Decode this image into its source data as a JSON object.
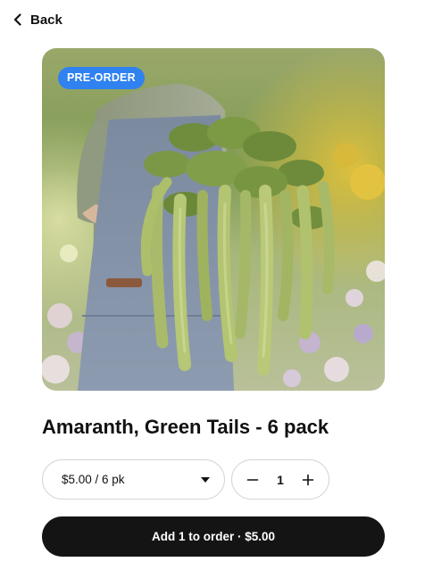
{
  "nav": {
    "back_label": "Back"
  },
  "product": {
    "badge": "PRE-ORDER",
    "title": "Amaranth, Green Tails - 6 pack"
  },
  "size_select": {
    "value": "$5.00 / 6 pk"
  },
  "quantity": {
    "value": "1"
  },
  "cta": {
    "label": "Add 1 to order · $5.00"
  },
  "colors": {
    "badge": "#2f82ef",
    "cta_background": "#141414",
    "border": "#d4d4d4"
  },
  "icons": {
    "back": "chevron-left-icon",
    "dropdown": "caret-down-icon",
    "decrement": "minus-icon",
    "increment": "plus-icon"
  }
}
